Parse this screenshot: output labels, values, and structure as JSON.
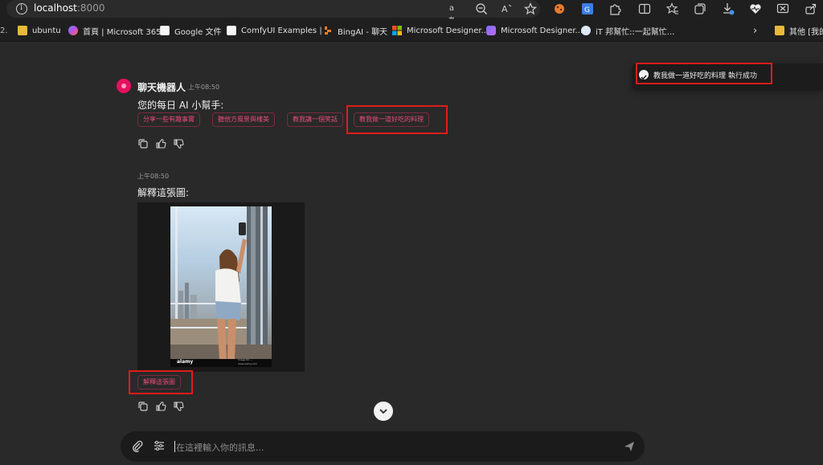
{
  "browser": {
    "url_host": "localhost",
    "url_port": ":8000",
    "read_aloud_label": "aあ",
    "zoom_icon": "zoom-out-icon",
    "bookmarks": [
      {
        "label": "ubuntu",
        "icon": "folder-icon"
      },
      {
        "label": "首頁 | Microsoft 365",
        "icon": "m365-icon"
      },
      {
        "label": "Google 文件",
        "icon": "doc-icon"
      },
      {
        "label": "ComfyUI Examples |...",
        "icon": "doc-icon"
      },
      {
        "label": "BingAI - 聊天",
        "icon": "bing-icon"
      },
      {
        "label": "Microsoft Designer...",
        "icon": "microsoft-icon"
      },
      {
        "label": "Microsoft Designer...",
        "icon": "designer-icon"
      },
      {
        "label": "iT 邦幫忙::一起幫忙...",
        "icon": "ithome-icon"
      }
    ],
    "other_bookmarks": "其他 [我的"
  },
  "chat": {
    "bot_name": "聊天機器人",
    "bot_time": "上午08:50",
    "bot_message": "您的每日 AI 小幫手:",
    "suggestions": [
      "分享一些有趣事實",
      "聽他方風景與樣美",
      "教我講一個笑話",
      "教我做一道好吃的料理"
    ],
    "user_time": "上午08:50",
    "user_message": "解釋這張圖:",
    "image_watermark": "alamy",
    "image_caption": "Image ID: ...",
    "image_credit": "www.alamy.com",
    "followup_chip": "解釋這張圖",
    "input_placeholder": "在這裡輸入你的訊息..."
  },
  "toast": {
    "message": "教我做一道好吃的料理 執行成功"
  },
  "colors": {
    "accent": "#e5105f",
    "chip_text": "#e84a7a",
    "highlight_box": "#e11b1b",
    "background": "#292929"
  }
}
